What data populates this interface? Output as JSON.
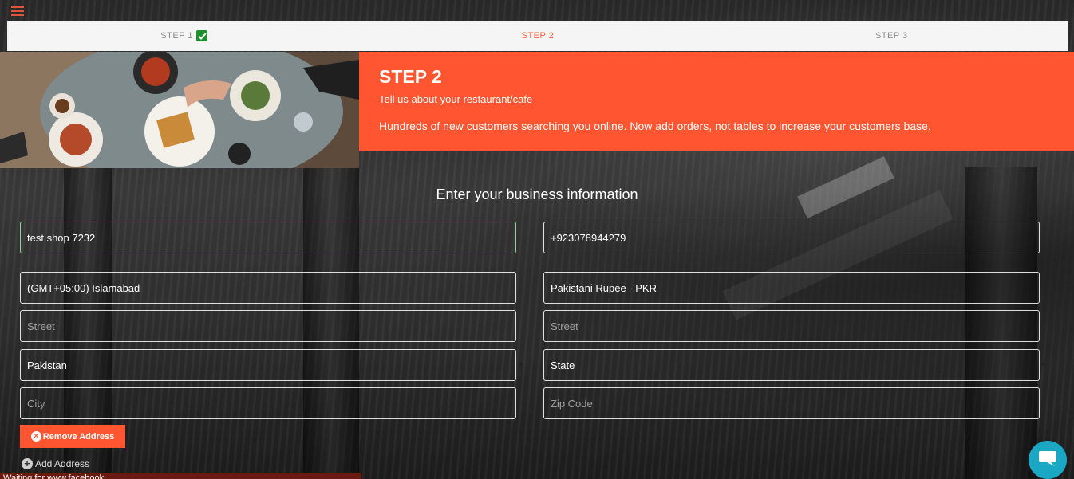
{
  "stepper": {
    "steps": [
      {
        "label": "STEP 1",
        "state": "done"
      },
      {
        "label": "STEP 2",
        "state": "active"
      },
      {
        "label": "STEP 3",
        "state": "pending"
      }
    ]
  },
  "hero": {
    "title": "STEP 2",
    "subtitle": "Tell us about your restaurant/cafe",
    "description": "Hundreds of new customers searching you online. Now add orders, not tables to increase your customers base."
  },
  "form": {
    "title": "Enter your business information",
    "business_name": "test shop 7232",
    "phone": "+923078944279",
    "timezone": "(GMT+05:00) Islamabad",
    "currency": "Pakistani Rupee - PKR",
    "street_left_placeholder": "Street",
    "street_right_placeholder": "Street",
    "country": "Pakistan",
    "state": "State",
    "city_placeholder": "City",
    "zip_placeholder": "Zip Code",
    "remove_address_label": "Remove Address",
    "add_address_label": "Add Address"
  },
  "toast": {
    "text": "Waiting for www.facebook..."
  },
  "colors": {
    "accent": "#ff5530",
    "step_done": "#1e8f2e",
    "chat": "#1aa7c4"
  },
  "icons": [
    "menu-icon",
    "checkmark-icon",
    "close-circle-icon",
    "plus-circle-icon",
    "chat-icon"
  ]
}
